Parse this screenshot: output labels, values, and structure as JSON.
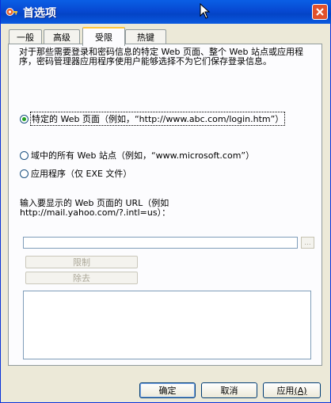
{
  "window": {
    "title": "首选项"
  },
  "tabs": [
    {
      "label": "一般"
    },
    {
      "label": "高级"
    },
    {
      "label": "受限"
    },
    {
      "label": "热键"
    }
  ],
  "restrictions": {
    "description": "对于那些需要登录和密码信息的特定 Web 页面、整个 Web 站点或应用程序，密码管理器应用程序使用户能够选择不为它们保存登录信息。",
    "options": [
      {
        "label": "特定的 Web 页面（例如，“http://www.abc.com/login.htm”）",
        "selected": true
      },
      {
        "label": "域中的所有 Web 站点（例如，“www.microsoft.com”）",
        "selected": false
      },
      {
        "label": "应用程序（仅 EXE 文件）",
        "selected": false
      }
    ],
    "url_prompt": "输入要显示的 Web 页面的 URL（例如 http://mail.yahoo.com/?.intl=us）：",
    "url_value": "",
    "browse_label": "...",
    "restrict_label": "限制",
    "remove_label": "除去"
  },
  "footer": {
    "ok_label": "确定",
    "cancel_label": "取消",
    "apply_label": "应用",
    "apply_mnemonic": "(A)"
  },
  "colors": {
    "titlebar": "#0a5fe5",
    "close_button": "#e2512b",
    "window_bg": "#ece9d8",
    "active_tab_accent": "#ffc73c"
  }
}
